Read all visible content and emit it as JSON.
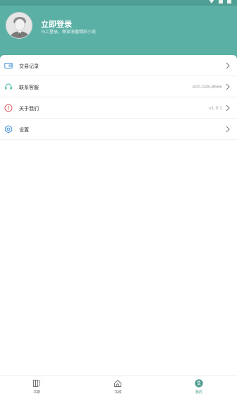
{
  "header": {
    "login_title": "立即登录",
    "login_subtitle": "马上登录，畅读海量精彩小说"
  },
  "menu": {
    "items": [
      {
        "label": "交易记录",
        "value": "",
        "icon": "wallet-icon"
      },
      {
        "label": "联系客服",
        "value": "400-028-8666",
        "icon": "headset-icon"
      },
      {
        "label": "关于我们",
        "value": "v1.0.1",
        "icon": "info-icon"
      },
      {
        "label": "设置",
        "value": "",
        "icon": "gear-icon"
      }
    ]
  },
  "tabbar": {
    "items": [
      {
        "label": "书架",
        "icon": "bookshelf-icon"
      },
      {
        "label": "书城",
        "icon": "home-icon"
      },
      {
        "label": "我的",
        "icon": "profile-icon"
      }
    ],
    "active_index": 2
  },
  "colors": {
    "header_bg": "#5bb0a6",
    "accent": "#4b9a8f",
    "status_bar": "#4f9e94"
  }
}
